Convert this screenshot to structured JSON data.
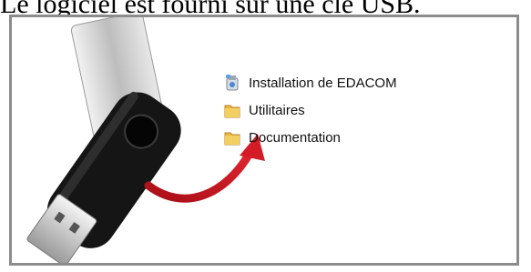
{
  "caption": "Le logiciel est fourni sur une clé USB.",
  "explorer": {
    "items": [
      {
        "label": "Installation de EDACOM",
        "icon": "installer-icon"
      },
      {
        "label": "Utilitaires",
        "icon": "folder-icon"
      },
      {
        "label": "Documentation",
        "icon": "folder-icon"
      }
    ]
  },
  "colors": {
    "folder": "#e9b940",
    "arrow": "#c8141e",
    "usb_body": "#151515",
    "usb_swivel": "#c9c9c9",
    "frame": "#8c8c8c"
  }
}
